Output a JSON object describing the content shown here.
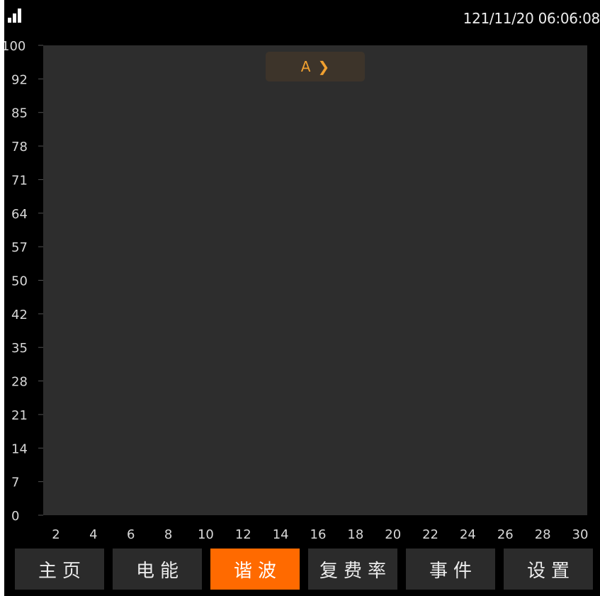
{
  "status": {
    "datetime": "121/11/20 06:06:08",
    "signal_icon": "signal-bars-icon"
  },
  "chart_data": {
    "type": "bar",
    "title": "",
    "xlabel": "",
    "ylabel": "",
    "y_ticks": [
      "100",
      "92",
      "85",
      "78",
      "71",
      "64",
      "57",
      "50",
      "42",
      "35",
      "28",
      "21",
      "14",
      "7",
      "0"
    ],
    "x_ticks": [
      "2",
      "4",
      "6",
      "8",
      "10",
      "12",
      "14",
      "16",
      "18",
      "20",
      "22",
      "24",
      "26",
      "28",
      "30"
    ],
    "ylim": [
      0,
      100
    ],
    "xlim": [
      1,
      31
    ],
    "series": [],
    "grid": false
  },
  "channel": {
    "label": "A",
    "chevron": "❯",
    "icon": "chevron-right-icon"
  },
  "nav": {
    "active": 2,
    "items": [
      {
        "label": "主页"
      },
      {
        "label": "电能"
      },
      {
        "label": "谐波"
      },
      {
        "label": "复费率"
      },
      {
        "label": "事件"
      },
      {
        "label": "设置"
      }
    ]
  },
  "colors": {
    "background": "#000000",
    "plot": "#2d2d2d",
    "axis_text": "#d8d8d8",
    "accent": "#ff6a00",
    "channel_text": "#f0a030"
  }
}
